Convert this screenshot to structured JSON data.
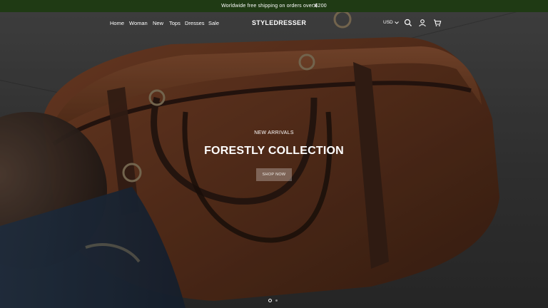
{
  "announcement": {
    "text": "Worldwide free shipping on orders over $200",
    "close_icon": "close-icon"
  },
  "header": {
    "nav": [
      {
        "label": "Home"
      },
      {
        "label": "Woman"
      },
      {
        "label": "New"
      },
      {
        "label": "Tops"
      },
      {
        "label": "Dresses"
      },
      {
        "label": "Sale"
      }
    ],
    "logo": "STYLEDRESSER",
    "currency": "USD",
    "icons": [
      "search-icon",
      "account-icon",
      "cart-icon"
    ]
  },
  "hero": {
    "eyebrow": "NEW ARRIVALS",
    "headline": "FORESTLY COLLECTION",
    "cta_label": "SHOP NOW",
    "slides_count": 2,
    "active_slide": 1
  },
  "colors": {
    "announcement_bg": "#1f3a14",
    "leather": "#6b3a22",
    "strap": "#3a2117"
  }
}
